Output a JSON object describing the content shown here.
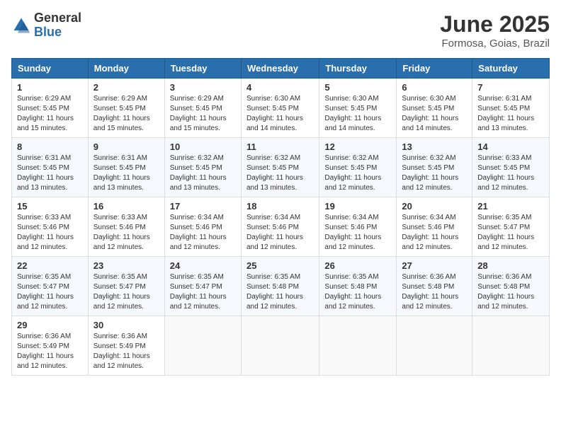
{
  "logo": {
    "general": "General",
    "blue": "Blue"
  },
  "title": "June 2025",
  "location": "Formosa, Goias, Brazil",
  "days_of_week": [
    "Sunday",
    "Monday",
    "Tuesday",
    "Wednesday",
    "Thursday",
    "Friday",
    "Saturday"
  ],
  "weeks": [
    [
      {
        "day": "1",
        "sunrise": "6:29 AM",
        "sunset": "5:45 PM",
        "daylight": "11 hours and 15 minutes."
      },
      {
        "day": "2",
        "sunrise": "6:29 AM",
        "sunset": "5:45 PM",
        "daylight": "11 hours and 15 minutes."
      },
      {
        "day": "3",
        "sunrise": "6:29 AM",
        "sunset": "5:45 PM",
        "daylight": "11 hours and 15 minutes."
      },
      {
        "day": "4",
        "sunrise": "6:30 AM",
        "sunset": "5:45 PM",
        "daylight": "11 hours and 14 minutes."
      },
      {
        "day": "5",
        "sunrise": "6:30 AM",
        "sunset": "5:45 PM",
        "daylight": "11 hours and 14 minutes."
      },
      {
        "day": "6",
        "sunrise": "6:30 AM",
        "sunset": "5:45 PM",
        "daylight": "11 hours and 14 minutes."
      },
      {
        "day": "7",
        "sunrise": "6:31 AM",
        "sunset": "5:45 PM",
        "daylight": "11 hours and 13 minutes."
      }
    ],
    [
      {
        "day": "8",
        "sunrise": "6:31 AM",
        "sunset": "5:45 PM",
        "daylight": "11 hours and 13 minutes."
      },
      {
        "day": "9",
        "sunrise": "6:31 AM",
        "sunset": "5:45 PM",
        "daylight": "11 hours and 13 minutes."
      },
      {
        "day": "10",
        "sunrise": "6:32 AM",
        "sunset": "5:45 PM",
        "daylight": "11 hours and 13 minutes."
      },
      {
        "day": "11",
        "sunrise": "6:32 AM",
        "sunset": "5:45 PM",
        "daylight": "11 hours and 13 minutes."
      },
      {
        "day": "12",
        "sunrise": "6:32 AM",
        "sunset": "5:45 PM",
        "daylight": "11 hours and 12 minutes."
      },
      {
        "day": "13",
        "sunrise": "6:32 AM",
        "sunset": "5:45 PM",
        "daylight": "11 hours and 12 minutes."
      },
      {
        "day": "14",
        "sunrise": "6:33 AM",
        "sunset": "5:45 PM",
        "daylight": "11 hours and 12 minutes."
      }
    ],
    [
      {
        "day": "15",
        "sunrise": "6:33 AM",
        "sunset": "5:46 PM",
        "daylight": "11 hours and 12 minutes."
      },
      {
        "day": "16",
        "sunrise": "6:33 AM",
        "sunset": "5:46 PM",
        "daylight": "11 hours and 12 minutes."
      },
      {
        "day": "17",
        "sunrise": "6:34 AM",
        "sunset": "5:46 PM",
        "daylight": "11 hours and 12 minutes."
      },
      {
        "day": "18",
        "sunrise": "6:34 AM",
        "sunset": "5:46 PM",
        "daylight": "11 hours and 12 minutes."
      },
      {
        "day": "19",
        "sunrise": "6:34 AM",
        "sunset": "5:46 PM",
        "daylight": "11 hours and 12 minutes."
      },
      {
        "day": "20",
        "sunrise": "6:34 AM",
        "sunset": "5:46 PM",
        "daylight": "11 hours and 12 minutes."
      },
      {
        "day": "21",
        "sunrise": "6:35 AM",
        "sunset": "5:47 PM",
        "daylight": "11 hours and 12 minutes."
      }
    ],
    [
      {
        "day": "22",
        "sunrise": "6:35 AM",
        "sunset": "5:47 PM",
        "daylight": "11 hours and 12 minutes."
      },
      {
        "day": "23",
        "sunrise": "6:35 AM",
        "sunset": "5:47 PM",
        "daylight": "11 hours and 12 minutes."
      },
      {
        "day": "24",
        "sunrise": "6:35 AM",
        "sunset": "5:47 PM",
        "daylight": "11 hours and 12 minutes."
      },
      {
        "day": "25",
        "sunrise": "6:35 AM",
        "sunset": "5:48 PM",
        "daylight": "11 hours and 12 minutes."
      },
      {
        "day": "26",
        "sunrise": "6:35 AM",
        "sunset": "5:48 PM",
        "daylight": "11 hours and 12 minutes."
      },
      {
        "day": "27",
        "sunrise": "6:36 AM",
        "sunset": "5:48 PM",
        "daylight": "11 hours and 12 minutes."
      },
      {
        "day": "28",
        "sunrise": "6:36 AM",
        "sunset": "5:48 PM",
        "daylight": "11 hours and 12 minutes."
      }
    ],
    [
      {
        "day": "29",
        "sunrise": "6:36 AM",
        "sunset": "5:49 PM",
        "daylight": "11 hours and 12 minutes."
      },
      {
        "day": "30",
        "sunrise": "6:36 AM",
        "sunset": "5:49 PM",
        "daylight": "11 hours and 12 minutes."
      },
      null,
      null,
      null,
      null,
      null
    ]
  ]
}
